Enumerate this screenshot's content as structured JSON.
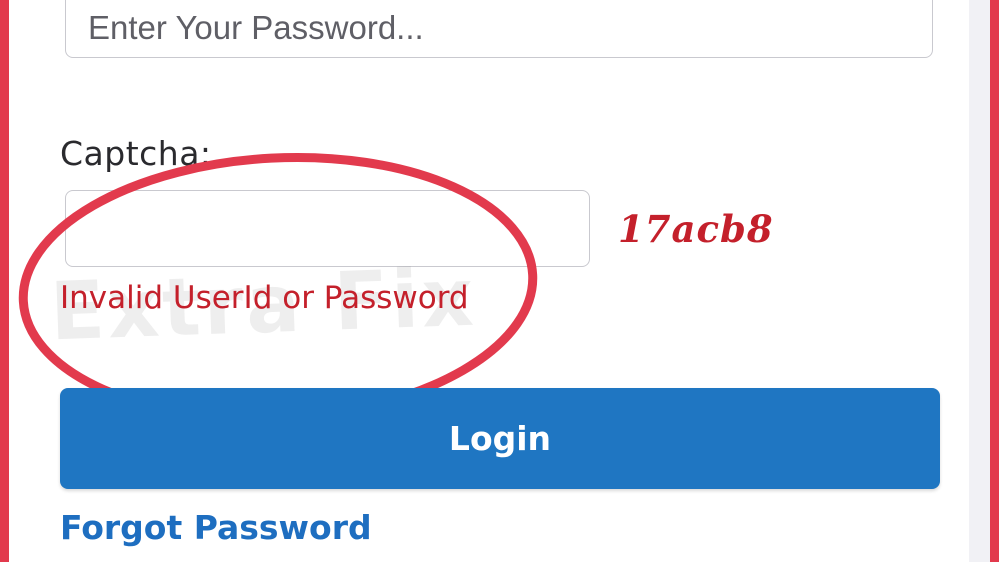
{
  "login_form": {
    "password_placeholder": "Enter Your Password...",
    "captcha_label": "Captcha:",
    "captcha_value": "",
    "captcha_code": "17acb8",
    "error_message": "Invalid UserId or Password",
    "login_label": "Login",
    "forgot_label": "Forgot Password"
  },
  "overlay": {
    "watermark_text": "Extra Fix"
  },
  "colors": {
    "frame": "#e23a4d",
    "accent": "#1f76c2",
    "error": "#c4202b",
    "link": "#1e6ec0"
  }
}
